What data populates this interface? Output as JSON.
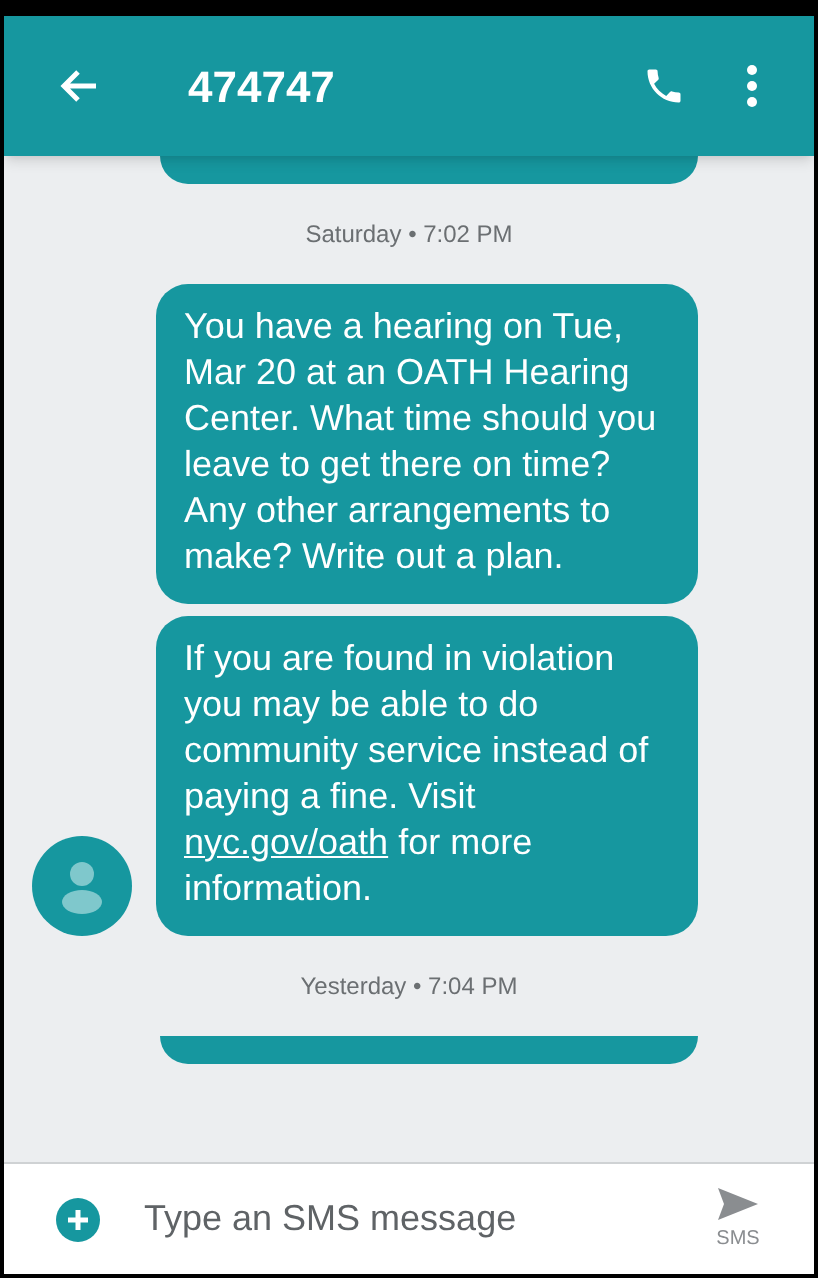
{
  "header": {
    "title": "474747"
  },
  "timeline": [
    {
      "kind": "partial_bubble"
    },
    {
      "kind": "timestamp",
      "text": "Saturday • 7:02 PM"
    },
    {
      "kind": "message",
      "avatar": false,
      "text": "You have a hearing on Tue, Mar 20 at an OATH Hearing Center. What time should you leave to get there on time? Any other arrangements to make? Write out a plan."
    },
    {
      "kind": "message",
      "avatar": true,
      "text": "If you are found in violation you may be able to do community service instead of paying a fine. Visit ",
      "link": "nyc.gov/oath",
      "text_after": " for more information."
    },
    {
      "kind": "timestamp",
      "text": "Yesterday • 7:04 PM"
    },
    {
      "kind": "partial_bubble"
    }
  ],
  "composer": {
    "placeholder": "Type an SMS message",
    "send_label": "SMS"
  }
}
